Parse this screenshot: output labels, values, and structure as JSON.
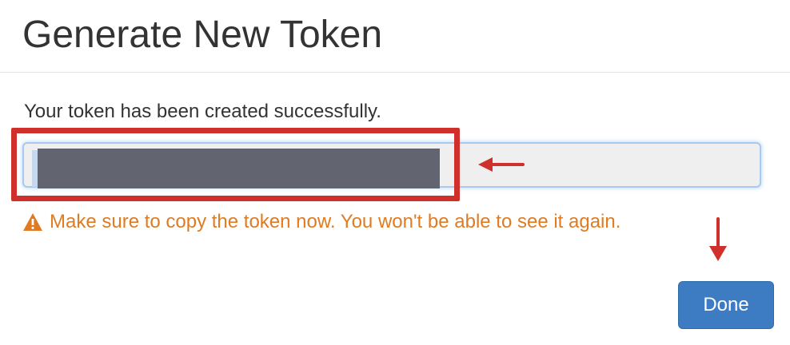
{
  "dialog": {
    "title": "Generate New Token",
    "success_message": "Your token has been created successfully.",
    "token_field": {
      "value": "",
      "redacted": true
    },
    "warning": {
      "icon": "warning-triangle-icon",
      "text": "Make sure to copy the token now. You won't be able to see it again."
    },
    "done_button": {
      "label": "Done"
    }
  },
  "annotations": {
    "highlight_color": "#d0302b",
    "arrow_icons": [
      "arrow-left-icon",
      "arrow-down-icon"
    ]
  },
  "colors": {
    "warning": "#e07b22",
    "primary_button": "#3d7cc3",
    "input_background": "#efefef",
    "redaction": "#626570"
  }
}
